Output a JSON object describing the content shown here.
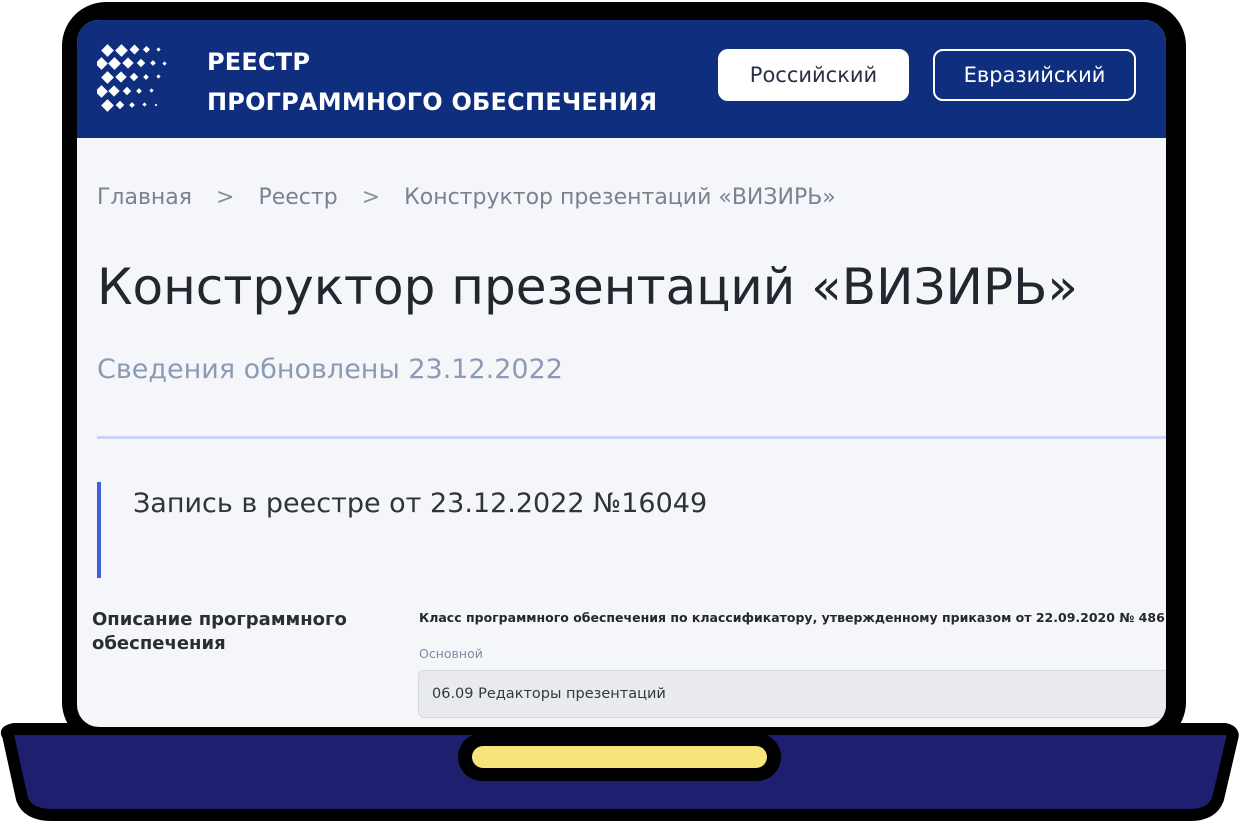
{
  "header": {
    "brand_line1": "РЕЕСТР",
    "brand_line2": "ПРОГРАММНОГО ОБЕСПЕЧЕНИЯ",
    "btn_russian": "Российский",
    "btn_eurasian": "Евразийский"
  },
  "breadcrumb": {
    "home": "Главная",
    "registry": "Реестр",
    "current": "Конструктор презентаций «ВИЗИРЬ»",
    "separator": ">"
  },
  "page": {
    "title": "Конструктор презентаций «ВИЗИРЬ»",
    "updated": "Сведения обновлены 23.12.2022",
    "record": "Запись в реестре от 23.12.2022 №16049"
  },
  "details": {
    "section_label": "Описание программного обеспечения",
    "class_title": "Класс программного обеспечения по классификатору, утвержденному приказом от 22.09.2020 № 486",
    "field_label": "Основной",
    "field_value": "06.09 Редакторы презентаций"
  },
  "colors": {
    "header_bg": "#0f2f7e",
    "accent_bar": "#3e63d6",
    "laptop_base": "#1e1f6f",
    "touchpad": "#f7e37a"
  }
}
